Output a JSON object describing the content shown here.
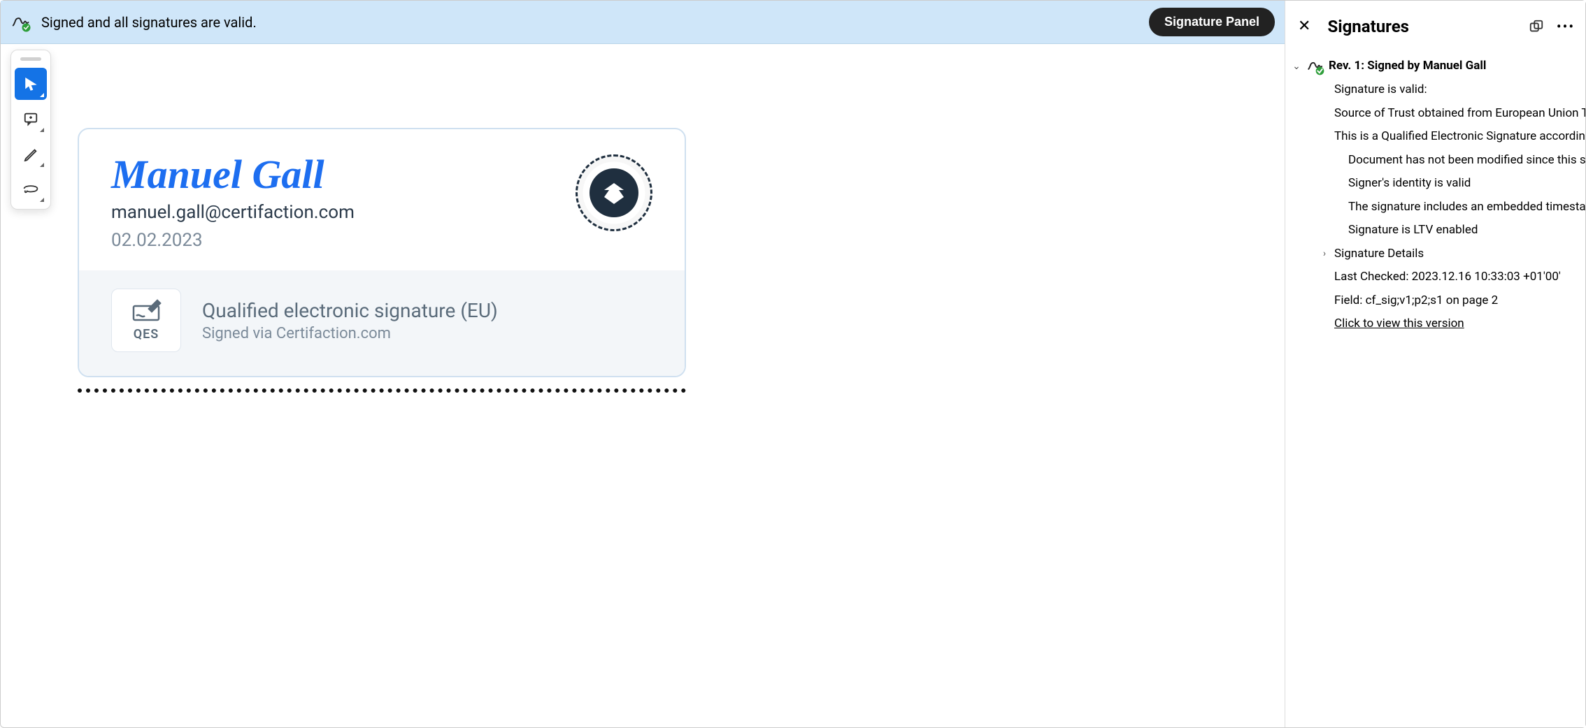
{
  "banner": {
    "status_text": "Signed and all signatures are valid.",
    "panel_button": "Signature Panel"
  },
  "toolbar": {
    "tools": [
      "select",
      "comment",
      "draw",
      "lasso"
    ]
  },
  "signature_card": {
    "signer_name": "Manuel Gall",
    "signer_email": "manuel.gall@certifaction.com",
    "sign_date": "02.02.2023",
    "qes_badge_label": "QES",
    "qes_title": "Qualified electronic signature (EU)",
    "qes_subtitle": "Signed via Certifaction.com"
  },
  "side_panel": {
    "title": "Signatures",
    "rev_title": "Rev. 1: Signed by Manuel Gall",
    "lines": {
      "valid": "Signature is valid:",
      "source": "Source of Trust obtained from European Union Trusted L",
      "qualified": "This is a Qualified Electronic Signature according to EU R",
      "not_modified": "Document has not been modified since this signature",
      "identity": "Signer's identity is valid",
      "timestamp": "The signature includes an embedded timestamp.",
      "ltv": "Signature is LTV enabled",
      "details_header": "Signature Details",
      "last_checked": "Last Checked: 2023.12.16 10:33:03 +01'00'",
      "field": "Field: cf_sig;v1;p2;s1 on page 2",
      "view_version": "Click to view this version"
    }
  }
}
